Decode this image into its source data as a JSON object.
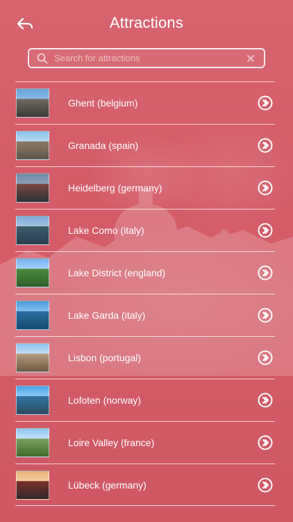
{
  "header": {
    "title": "Attractions"
  },
  "search": {
    "placeholder": "Search for attractions",
    "value": ""
  },
  "list": {
    "items": [
      {
        "label": "Ghent (belgium)"
      },
      {
        "label": "Granada (spain)"
      },
      {
        "label": "Heidelberg (germany)"
      },
      {
        "label": "Lake Como (italy)"
      },
      {
        "label": "Lake District (england)"
      },
      {
        "label": "Lake Garda (italy)"
      },
      {
        "label": "Lisbon (portugal)"
      },
      {
        "label": "Lofoten (norway)"
      },
      {
        "label": "Loire Valley (france)"
      },
      {
        "label": "Lübeck (germany)"
      }
    ]
  },
  "icons": {
    "back": "back-arrow-icon",
    "search": "search-icon",
    "clear": "clear-icon",
    "row_action": "double-chevron-right-icon"
  },
  "colors": {
    "background": "#d45c69",
    "text": "#ffffff",
    "lines": "#ffffff"
  }
}
